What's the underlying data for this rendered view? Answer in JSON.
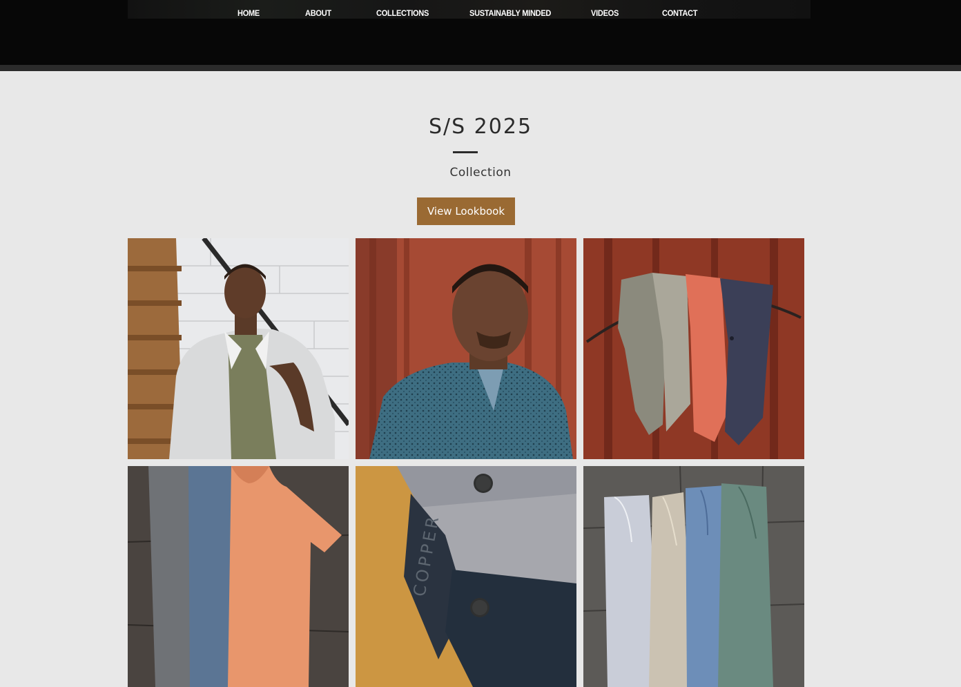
{
  "nav": {
    "items": [
      {
        "label": "HOME"
      },
      {
        "label": "ABOUT"
      },
      {
        "label": "COLLECTIONS"
      },
      {
        "label": "SUSTAINABLY MINDED"
      },
      {
        "label": "VIDEOS"
      },
      {
        "label": "CONTACT"
      }
    ]
  },
  "hero": {
    "title": "S/S 2025",
    "subtitle": "Collection",
    "button_label": "View Lookbook"
  },
  "gallery": {
    "tiles": [
      {
        "subject": "man in white short-sleeve shirt over olive polo by white brick wall and stairs"
      },
      {
        "subject": "man in blue printed button shirt against red wall"
      },
      {
        "subject": "three folded shirts hanging on hoop against red wall"
      },
      {
        "subject": "gray, blue and orange t-shirts laid flat on slate"
      },
      {
        "subject": "close-up of gray and navy pants with buttons"
      },
      {
        "subject": "four drawstring pants laid on slate floor"
      }
    ],
    "photo_text": "COPPER"
  },
  "colors": {
    "background": "#e8e8e8",
    "header": "#070707",
    "button": "#9a6a33",
    "text": "#2b2b2b"
  }
}
